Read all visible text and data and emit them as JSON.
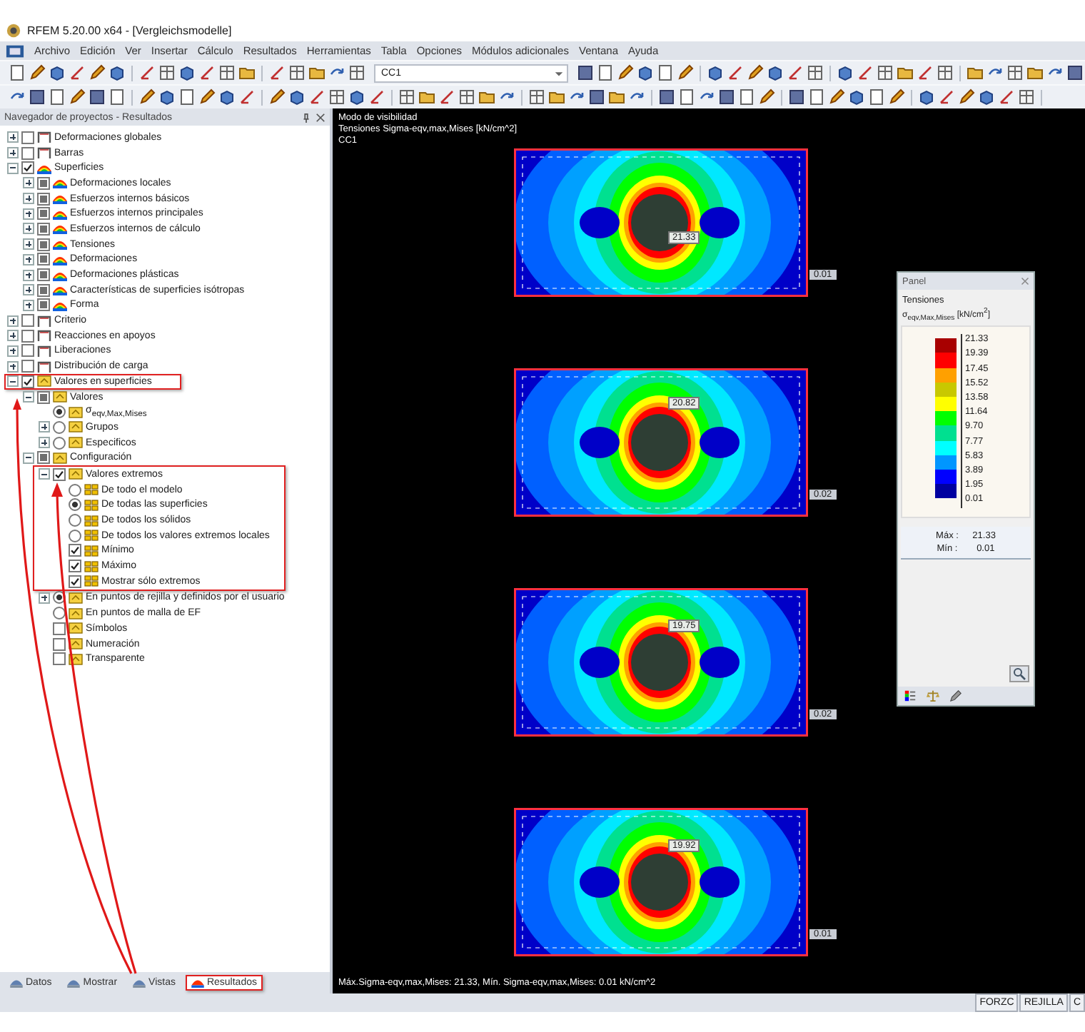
{
  "window": {
    "title": "RFEM 5.20.00 x64 - [Vergleichsmodelle]"
  },
  "menu": [
    "Archivo",
    "Edición",
    "Ver",
    "Insertar",
    "Cálculo",
    "Resultados",
    "Herramientas",
    "Tabla",
    "Opciones",
    "Módulos adicionales",
    "Ventana",
    "Ayuda"
  ],
  "toolbar": {
    "load_case": "CC1"
  },
  "navigator": {
    "title": "Navegador de proyectos - Resultados",
    "tree": [
      {
        "label": "Deformaciones globales",
        "kind": "checkbox",
        "checked": false,
        "expanded": false
      },
      {
        "label": "Barras",
        "kind": "checkbox",
        "checked": false,
        "expanded": false
      },
      {
        "label": "Superficies",
        "kind": "checkbox",
        "checked": true,
        "expanded": true,
        "children": [
          {
            "label": "Deformaciones locales",
            "kind": "checkbox",
            "mixed": true,
            "expanded": false
          },
          {
            "label": "Esfuerzos internos básicos",
            "kind": "checkbox",
            "mixed": true,
            "expanded": false
          },
          {
            "label": "Esfuerzos internos principales",
            "kind": "checkbox",
            "mixed": true,
            "expanded": false
          },
          {
            "label": "Esfuerzos internos de cálculo",
            "kind": "checkbox",
            "mixed": true,
            "expanded": false
          },
          {
            "label": "Tensiones",
            "kind": "checkbox",
            "mixed": true,
            "expanded": false
          },
          {
            "label": "Deformaciones",
            "kind": "checkbox",
            "mixed": true,
            "expanded": false
          },
          {
            "label": "Deformaciones plásticas",
            "kind": "checkbox",
            "mixed": true,
            "expanded": false
          },
          {
            "label": "Características de superficies isótropas",
            "kind": "checkbox",
            "mixed": true,
            "expanded": false
          },
          {
            "label": "Forma",
            "kind": "checkbox",
            "mixed": true,
            "expanded": false
          }
        ]
      },
      {
        "label": "Criterio",
        "kind": "checkbox",
        "checked": false,
        "expanded": false
      },
      {
        "label": "Reacciones en apoyos",
        "kind": "checkbox",
        "checked": false,
        "expanded": false
      },
      {
        "label": "Liberaciones",
        "kind": "checkbox",
        "checked": false,
        "expanded": false
      },
      {
        "label": "Distribución de carga",
        "kind": "checkbox",
        "checked": false,
        "expanded": false
      },
      {
        "label": "Valores en superficies",
        "kind": "checkbox",
        "checked": true,
        "expanded": true,
        "highlighted": true,
        "children": [
          {
            "label": "Valores",
            "kind": "checkbox",
            "mixed": true,
            "expanded": true,
            "children": [
              {
                "label": "σ$_{eqv,Max,Mises}$",
                "kind": "radio",
                "selected": true
              },
              {
                "label": "Grupos",
                "kind": "radio",
                "selected": false,
                "expanded": false
              },
              {
                "label": "Especificos",
                "kind": "radio",
                "selected": false,
                "expanded": false
              }
            ]
          },
          {
            "label": "Configuración",
            "kind": "checkbox",
            "mixed": true,
            "expanded": true,
            "children": [
              {
                "label": "Valores extremos",
                "kind": "checkbox",
                "checked": true,
                "expanded": true,
                "group_highlighted": true,
                "children": [
                  {
                    "label": "De todo el modelo",
                    "kind": "radio",
                    "selected": false
                  },
                  {
                    "label": "De todas las superficies",
                    "kind": "radio",
                    "selected": true
                  },
                  {
                    "label": "De todos los sólidos",
                    "kind": "radio",
                    "selected": false
                  },
                  {
                    "label": "De todos los valores extremos locales",
                    "kind": "radio",
                    "selected": false
                  },
                  {
                    "label": "Mínimo",
                    "kind": "checkbox",
                    "checked": true
                  },
                  {
                    "label": "Máximo",
                    "kind": "checkbox",
                    "checked": true
                  },
                  {
                    "label": "Mostrar sólo extremos",
                    "kind": "checkbox",
                    "checked": true
                  }
                ]
              },
              {
                "label": "En puntos de rejilla y definidos por el usuario",
                "kind": "radio",
                "selected": true,
                "expanded": false
              },
              {
                "label": "En puntos de malla de EF",
                "kind": "radio",
                "selected": false
              },
              {
                "label": "Símbolos",
                "kind": "checkbox",
                "checked": false
              },
              {
                "label": "Numeración",
                "kind": "checkbox",
                "checked": false
              },
              {
                "label": "Transparente",
                "kind": "checkbox",
                "checked": false
              }
            ]
          }
        ]
      }
    ],
    "tabs": [
      {
        "label": "Datos",
        "selected": false,
        "highlighted": false
      },
      {
        "label": "Mostrar",
        "selected": false,
        "highlighted": false
      },
      {
        "label": "Vistas",
        "selected": false,
        "highlighted": false
      },
      {
        "label": "Resultados",
        "selected": true,
        "highlighted": true
      }
    ]
  },
  "viewport": {
    "header": [
      "Modo de visibilidad",
      "Tensiones Sigma-eqv,max,Mises [kN/cm^2]",
      "CC1"
    ],
    "plates": [
      {
        "max_label": "21.33",
        "min_label": "0.01"
      },
      {
        "max_label": "20.82",
        "min_label": "0.02"
      },
      {
        "max_label": "19.75",
        "min_label": "0.02"
      },
      {
        "max_label": "19.92",
        "min_label": "0.01"
      }
    ],
    "footer": "Máx.Sigma-eqv,max,Mises: 21.33, Mín. Sigma-eqv,max,Mises: 0.01 kN/cm^2"
  },
  "panel": {
    "title": "Panel",
    "quantity": "Tensiones",
    "unit": "σ$_{eqv,Max,Mises}$ [kN/cm$^{2}$]",
    "values": [
      "21.33",
      "19.39",
      "17.45",
      "15.52",
      "13.58",
      "11.64",
      "9.70",
      "7.77",
      "5.83",
      "3.89",
      "1.95",
      "0.01"
    ],
    "bands": [
      {
        "color": "#a80000"
      },
      {
        "color": "#ff0000"
      },
      {
        "color": "#ffa000"
      },
      {
        "color": "#c8c800"
      },
      {
        "color": "#ffff00"
      },
      {
        "color": "#00ff00"
      },
      {
        "color": "#00e090"
      },
      {
        "color": "#00ffff"
      },
      {
        "color": "#0096ff"
      },
      {
        "color": "#0000ff"
      },
      {
        "color": "#0000a0"
      }
    ],
    "extremes": [
      {
        "label": "Máx :",
        "value": "21.33"
      },
      {
        "label": "Mín :",
        "value": "0.01"
      }
    ]
  },
  "status_bar": [
    "FORZC",
    "REJILLA",
    "C"
  ]
}
